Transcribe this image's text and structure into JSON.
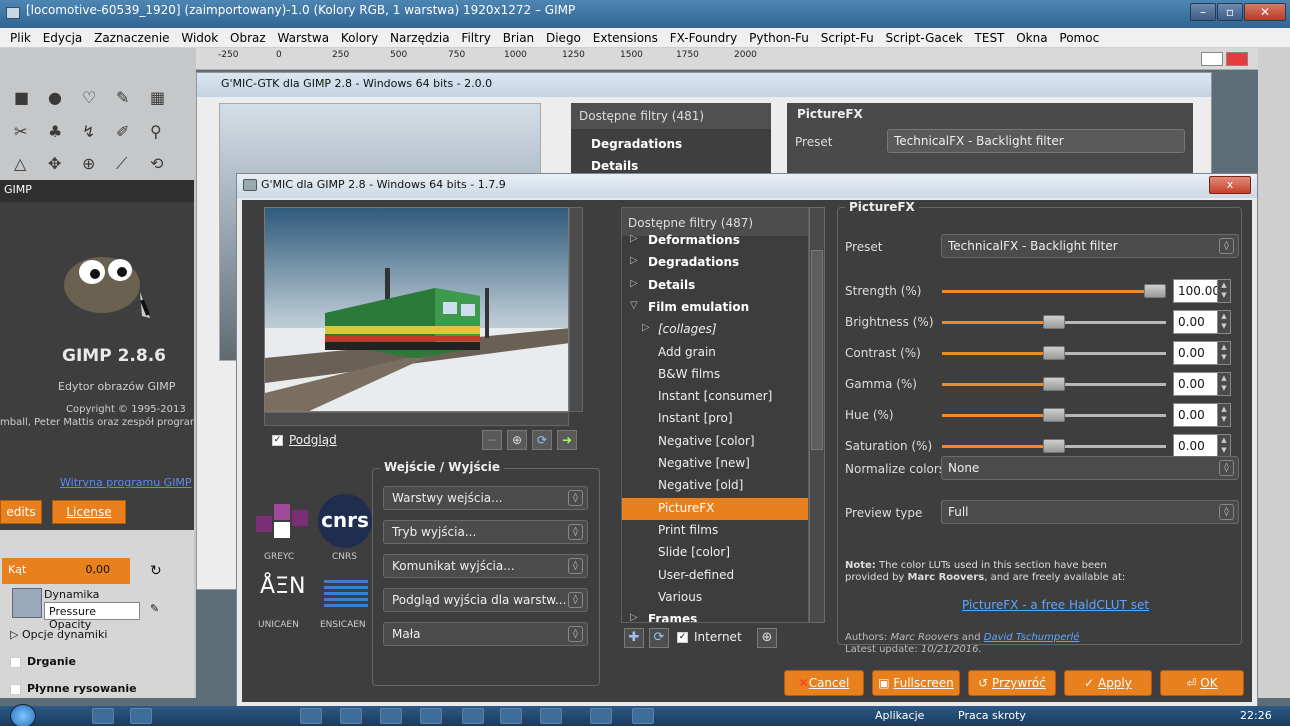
{
  "gimp": {
    "window_title": "[locomotive-60539_1920] (zaimportowany)-1.0 (Kolory RGB, 1 warstwa) 1920x1272 – GIMP",
    "menu": [
      "Plik",
      "Edycja",
      "Zaznaczenie",
      "Widok",
      "Obraz",
      "Warstwa",
      "Kolory",
      "Narzędzia",
      "Filtry",
      "Brian",
      "Diego",
      "Extensions",
      "FX-Foundry",
      "Python-Fu",
      "Script-Fu",
      "Script-Gacek",
      "TEST",
      "Okna",
      "Pomoc"
    ],
    "ruler_marks": [
      "-250",
      "0",
      "250",
      "500",
      "750",
      "1000",
      "1250",
      "1500",
      "1750",
      "2000"
    ],
    "about_strip": "GIMP",
    "about": {
      "version": "GIMP 2.8.6",
      "subtitle": "Edytor obrazów GIMP",
      "copyright": "Copyright © 1995-2013",
      "authors": "mball, Peter Mattis oraz zespół programis",
      "website": "Witryna programu GIMP",
      "credits_btn": "edits",
      "license_btn": "License"
    },
    "tool_options": {
      "angle_label": "Kąt",
      "angle_value": "0,00",
      "dynamics_label": "Dynamika",
      "dynamics_value": "Pressure Opacity",
      "dynamics_options": "Opcje dynamiki",
      "jitter": "Drganie",
      "smooth": "Płynne rysowanie"
    }
  },
  "gmic_old": {
    "title": "G'MIC-GTK dla GIMP 2.8 - Windows 64 bits - 2.0.0",
    "filters_header": "Dostępne filtry (481)",
    "filters": [
      "Degradations",
      "Details"
    ],
    "right_title": "PictureFX",
    "preset_label": "Preset",
    "preset_value": "TechnicalFX - Backlight filter"
  },
  "gmic": {
    "title": "G'MIC dla GIMP 2.8 - Windows 64 bits - 1.7.9",
    "close": "x",
    "preview_label": "Podgląd",
    "preview_checked": true,
    "io": {
      "title": "Wejście / Wyjście",
      "input_layers": "Warstwy wejścia...",
      "output_mode": "Tryb wyjścia...",
      "output_message": "Komunikat wyjścia...",
      "output_preview": "Podgląd wyjścia dla warstw...",
      "size": "Mała"
    },
    "logos": {
      "greyc": "GREYC",
      "cnrs_text": "CNRS",
      "cnrs_logo": "cnrs",
      "unicaen": "UNICAEN",
      "ensicaen": "ENSICAEN"
    },
    "filters_header": "Dostępne filtry (487)",
    "filters": [
      {
        "label": "Deformations",
        "kind": "cat",
        "arrow": "▷"
      },
      {
        "label": "Degradations",
        "kind": "cat",
        "arrow": "▷"
      },
      {
        "label": "Details",
        "kind": "cat",
        "arrow": "▷"
      },
      {
        "label": "Film emulation",
        "kind": "cat",
        "arrow": "▽"
      },
      {
        "label": "[collages]",
        "kind": "sub",
        "arrow": "▷"
      },
      {
        "label": "Add grain",
        "kind": "item"
      },
      {
        "label": "B&W films",
        "kind": "item"
      },
      {
        "label": "Instant [consumer]",
        "kind": "item"
      },
      {
        "label": "Instant [pro]",
        "kind": "item"
      },
      {
        "label": "Negative [color]",
        "kind": "item"
      },
      {
        "label": "Negative [new]",
        "kind": "item"
      },
      {
        "label": "Negative [old]",
        "kind": "item"
      },
      {
        "label": "PictureFX",
        "kind": "selected"
      },
      {
        "label": "Print films",
        "kind": "item"
      },
      {
        "label": "Slide [color]",
        "kind": "item"
      },
      {
        "label": "User-defined",
        "kind": "item"
      },
      {
        "label": "Various",
        "kind": "item"
      },
      {
        "label": "Frames",
        "kind": "cat",
        "arrow": "▷"
      }
    ],
    "internet_label": "Internet",
    "params": {
      "title": "PictureFX",
      "preset_label": "Preset",
      "preset_value": "TechnicalFX - Backlight filter",
      "sliders": [
        {
          "label": "Strength (%)",
          "value": "100.00",
          "fraction": 1.0
        },
        {
          "label": "Brightness (%)",
          "value": "0.00",
          "fraction": 0.5
        },
        {
          "label": "Contrast (%)",
          "value": "0.00",
          "fraction": 0.5
        },
        {
          "label": "Gamma (%)",
          "value": "0.00",
          "fraction": 0.5
        },
        {
          "label": "Hue (%)",
          "value": "0.00",
          "fraction": 0.5
        },
        {
          "label": "Saturation (%)",
          "value": "0.00",
          "fraction": 0.5
        }
      ],
      "normalize_label": "Normalize colors",
      "normalize_value": "None",
      "preview_type_label": "Preview type",
      "preview_type_value": "Full",
      "note_bold": "Note:",
      "note_text": "The color LUTs used in this section have been",
      "note_text2": "provided by",
      "note_author": "Marc Roovers",
      "note_text3": ", and are freely available at:",
      "note_link": "PictureFX - a free HaldCLUT set",
      "authors_prefix": "Authors:",
      "author1": "Marc Roovers",
      "authors_and": "and",
      "author2": "David Tschumperlé",
      "latest_prefix": "Latest update:",
      "latest_date": "10/21/2016."
    },
    "buttons": {
      "cancel": "Cancel",
      "fullscreen": "Fullscreen",
      "reset": "Przywróć",
      "apply": "Apply",
      "ok": "OK"
    }
  },
  "taskbar": {
    "apps": "Aplikacje",
    "links": "Praca skroty",
    "clock": "22:26"
  }
}
